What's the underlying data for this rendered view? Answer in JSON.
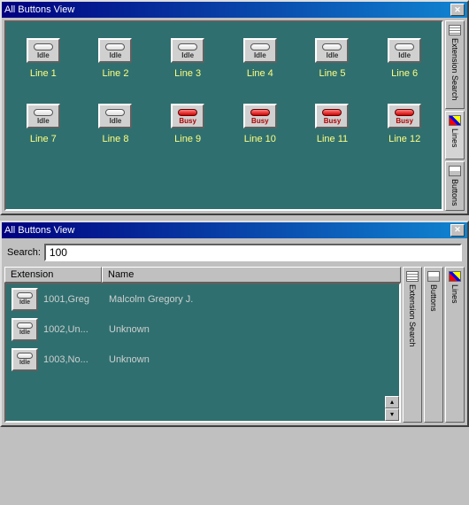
{
  "window1": {
    "title": "All Buttons View",
    "tabs": [
      {
        "label": "Extension Search",
        "icon": "grid"
      },
      {
        "label": "Lines",
        "icon": "lines"
      },
      {
        "label": "Buttons",
        "icon": "buttons"
      }
    ],
    "lines": [
      {
        "label": "Line 1",
        "status": "Idle",
        "state": "idle"
      },
      {
        "label": "Line 2",
        "status": "Idle",
        "state": "idle"
      },
      {
        "label": "Line 3",
        "status": "Idle",
        "state": "idle"
      },
      {
        "label": "Line 4",
        "status": "Idle",
        "state": "idle"
      },
      {
        "label": "Line 5",
        "status": "Idle",
        "state": "idle"
      },
      {
        "label": "Line 6",
        "status": "Idle",
        "state": "idle"
      },
      {
        "label": "Line 7",
        "status": "Idle",
        "state": "idle"
      },
      {
        "label": "Line 8",
        "status": "Idle",
        "state": "idle"
      },
      {
        "label": "Line 9",
        "status": "Busy",
        "state": "busy"
      },
      {
        "label": "Line 10",
        "status": "Busy",
        "state": "busy"
      },
      {
        "label": "Line 11",
        "status": "Busy",
        "state": "busy"
      },
      {
        "label": "Line 12",
        "status": "Busy",
        "state": "busy"
      }
    ]
  },
  "window2": {
    "title": "All Buttons View",
    "search_label": "Search:",
    "search_value": "100",
    "columns": {
      "ext": "Extension",
      "name": "Name"
    },
    "rows": [
      {
        "ext": "1001,Greg",
        "name": "Malcolm Gregory J.",
        "status": "Idle",
        "state": "idle"
      },
      {
        "ext": "1002,Un...",
        "name": "Unknown",
        "status": "Idle",
        "state": "idle"
      },
      {
        "ext": "1003,No...",
        "name": "Unknown",
        "status": "Idle",
        "state": "idle"
      }
    ],
    "tabs": [
      {
        "label": "Extension Search",
        "icon": "grid"
      },
      {
        "label": "Buttons",
        "icon": "buttons"
      },
      {
        "label": "Lines",
        "icon": "lines"
      }
    ]
  }
}
